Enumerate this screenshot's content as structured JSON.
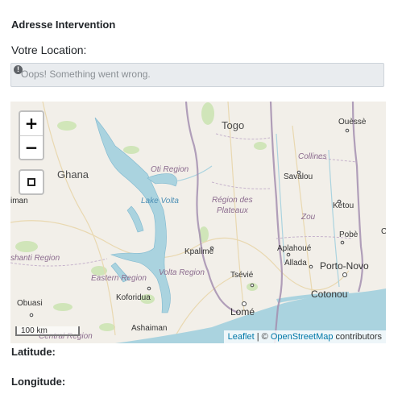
{
  "section_title": "Adresse Intervention",
  "location_label": "Votre Location:",
  "location_input": {
    "value": "",
    "placeholder": "Oops! Something went wrong.",
    "status_icon": "warning-icon"
  },
  "map": {
    "controls": {
      "zoom_in": "+",
      "zoom_out": "−",
      "draw_icon": "square-icon"
    },
    "scale_label": "100 km",
    "attribution": {
      "leaflet": "Leaflet",
      "separator": " | © ",
      "osm": "OpenStreetMap",
      "suffix": " contributors"
    },
    "places": {
      "togo": "Togo",
      "ghana": "Ghana",
      "ouesse": "Ouèssè",
      "oti": "Oti Region",
      "collines": "Collines",
      "savalou": "Savalou",
      "lake_volta": "Lake Volta",
      "plateaux_1": "Région des",
      "plateaux_2": "Plateaux",
      "ketou": "Kétou",
      "zou": "Zou",
      "iman": "iman",
      "pobe": "Pobè",
      "c": "C",
      "ashanti": "shanti Region",
      "aplahoue": "Aplahoué",
      "kpalime": "Kpalimé",
      "allada": "Allada",
      "porto_novo": "Porto-Novo",
      "eastern": "Eastern Region",
      "volta": "Volta Region",
      "tsevie": "Tsévié",
      "cotonou": "Cotonou",
      "koforidua": "Koforidua",
      "obuasi": "Obuasi",
      "lome": "Lomé",
      "ashaiman": "Ashaiman",
      "central": "Central Region"
    }
  },
  "latitude_label": "Latitude:",
  "longitude_label": "Longitude:"
}
